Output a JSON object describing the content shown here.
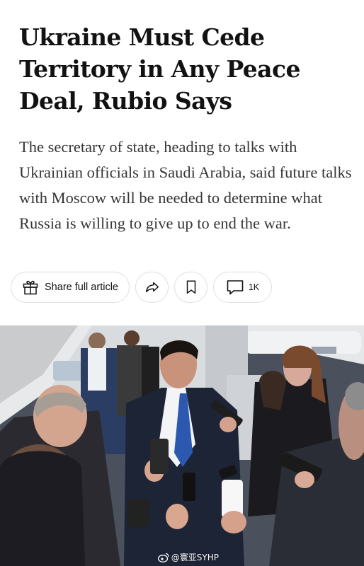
{
  "article": {
    "headline": "Ukraine Must Cede Territory in Any Peace Deal, Rubio Says",
    "summary": "The secretary of state, heading to talks with Ukrainian officials in Saudi Arabia, said future talks with Moscow will be needed to determine what Russia is willing to give up to end the war."
  },
  "actions": {
    "share_label": "Share full article",
    "share_icon": "gift-icon",
    "forward_icon": "share-arrow-icon",
    "save_icon": "bookmark-icon",
    "comments_icon": "comment-icon",
    "comments_count": "1K"
  },
  "photo": {
    "watermark": "@寰亚SYHP",
    "watermark_icon": "weibo-icon"
  },
  "colors": {
    "text": "#121212",
    "summary_text": "#363636",
    "pill_border": "#dfdfdf"
  }
}
